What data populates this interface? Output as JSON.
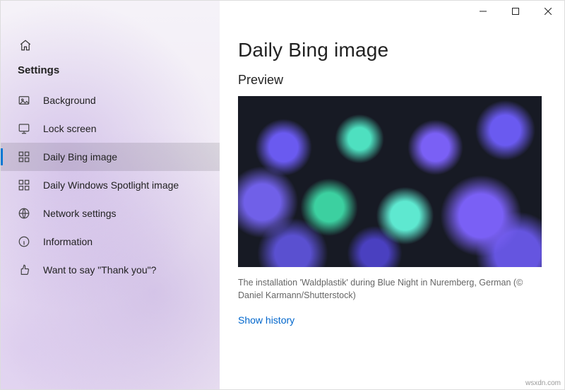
{
  "sidebar": {
    "heading": "Settings",
    "items": [
      {
        "label": "Background"
      },
      {
        "label": "Lock screen"
      },
      {
        "label": "Daily Bing image"
      },
      {
        "label": "Daily Windows Spotlight image"
      },
      {
        "label": "Network settings"
      },
      {
        "label": "Information"
      },
      {
        "label": "Want to say \"Thank you\"?"
      }
    ],
    "selected_index": 2
  },
  "main": {
    "title": "Daily Bing image",
    "preview_heading": "Preview",
    "caption": "The installation 'Waldplastik' during Blue Night in Nuremberg, German (© Daniel Karmann/Shutterstock)",
    "history_link": "Show history"
  },
  "watermark": "wsxdn.com"
}
